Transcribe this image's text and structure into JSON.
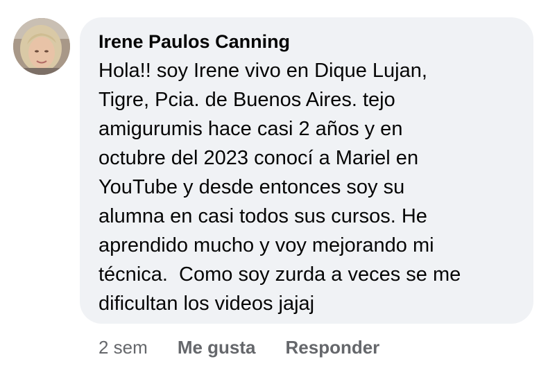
{
  "comment": {
    "author": "Irene Paulos Canning",
    "text_lines": [
      "Hola!! soy Irene vivo en Dique Lujan,",
      "Tigre, Pcia. de Buenos Aires. tejo",
      "amigurumis hace casi 2 años y en",
      "octubre del 2023 conocí a Mariel en",
      "YouTube y desde entonces soy su",
      "alumna en casi todos sus cursos. He",
      "aprendido mucho y voy mejorando mi",
      "técnica.  Como soy zurda a veces se me",
      "dificultan los videos jajaj"
    ],
    "timestamp": "2 sem",
    "like_label": "Me gusta",
    "reply_label": "Responder"
  },
  "colors": {
    "bubble_background": "#f0f2f5",
    "primary_text": "#050505",
    "secondary_text": "#65676b"
  }
}
